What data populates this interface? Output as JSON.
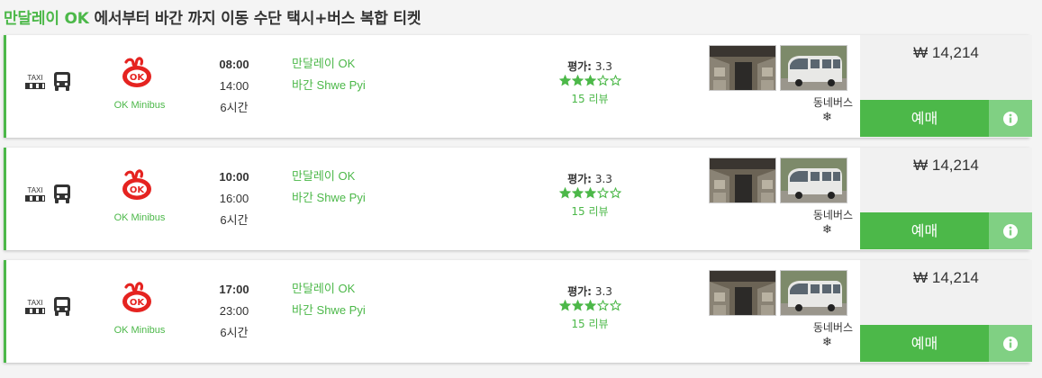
{
  "title": {
    "origin": "만달레이",
    "origin_suffix": "OK",
    "rest": "에서부터 바간 까지 이동 수단 택시+버스 복합 티켓"
  },
  "colors": {
    "accent": "#4cb849",
    "accent_light": "#80d083",
    "star": "#4cb849"
  },
  "icons": [
    "taxi-icon",
    "bus-icon",
    "ok-logo",
    "star-icon",
    "snowflake-icon",
    "info-icon"
  ],
  "trips": [
    {
      "taxi_label": "TAXI",
      "operator": "OK Minibus",
      "departure": "08:00",
      "arrival": "14:00",
      "duration": "6시간",
      "from": "만달레이 OK",
      "to": "바간 Shwe Pyi",
      "rating_label": "평가:",
      "rating_value": "3.3",
      "stars_filled": 3,
      "stars_total": 5,
      "reviews": "15 리뷰",
      "company": "동네버스",
      "amenity": "❄",
      "price": "₩ 14,214",
      "book_label": "예매"
    },
    {
      "taxi_label": "TAXI",
      "operator": "OK Minibus",
      "departure": "10:00",
      "arrival": "16:00",
      "duration": "6시간",
      "from": "만달레이 OK",
      "to": "바간 Shwe Pyi",
      "rating_label": "평가:",
      "rating_value": "3.3",
      "stars_filled": 3,
      "stars_total": 5,
      "reviews": "15 리뷰",
      "company": "동네버스",
      "amenity": "❄",
      "price": "₩ 14,214",
      "book_label": "예매"
    },
    {
      "taxi_label": "TAXI",
      "operator": "OK Minibus",
      "departure": "17:00",
      "arrival": "23:00",
      "duration": "6시간",
      "from": "만달레이 OK",
      "to": "바간 Shwe Pyi",
      "rating_label": "평가:",
      "rating_value": "3.3",
      "stars_filled": 3,
      "stars_total": 5,
      "reviews": "15 리뷰",
      "company": "동네버스",
      "amenity": "❄",
      "price": "₩ 14,214",
      "book_label": "예매"
    }
  ]
}
